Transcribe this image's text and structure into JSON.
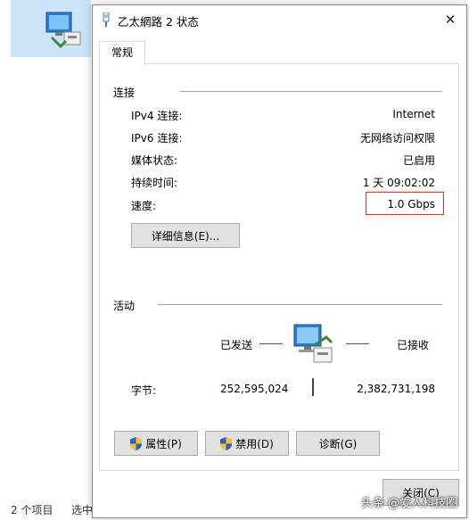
{
  "explorer": {
    "status_items": "2 个项目",
    "status_selected": "选中"
  },
  "dialog": {
    "title": "乙太網路 2 状态",
    "close_symbol": "✕",
    "tab_general": "常规",
    "connection": {
      "section_label": "连接",
      "rows": [
        {
          "label": "IPv4 连接:",
          "value": "Internet"
        },
        {
          "label": "IPv6 连接:",
          "value": "无网络访问权限"
        },
        {
          "label": "媒体状态:",
          "value": "已启用"
        },
        {
          "label": "持续时间:",
          "value": "1 天 09:02:02"
        },
        {
          "label": "速度:",
          "value": "1.0 Gbps"
        }
      ],
      "details_button": "详细信息(E)..."
    },
    "activity": {
      "section_label": "活动",
      "sent_label": "已发送",
      "received_label": "已接收",
      "bytes_label": "字节:",
      "bytes_sent": "252,595,024",
      "bytes_received": "2,382,731,198"
    },
    "buttons": {
      "properties": "属性(P)",
      "disable": "禁用(D)",
      "diagnose": "诊断(G)",
      "close": "关闭(C)"
    }
  },
  "watermark": "头条 @爱人科技圈",
  "colors": {
    "highlight_border": "#e0302a",
    "selection_bg": "#cce4f7"
  }
}
